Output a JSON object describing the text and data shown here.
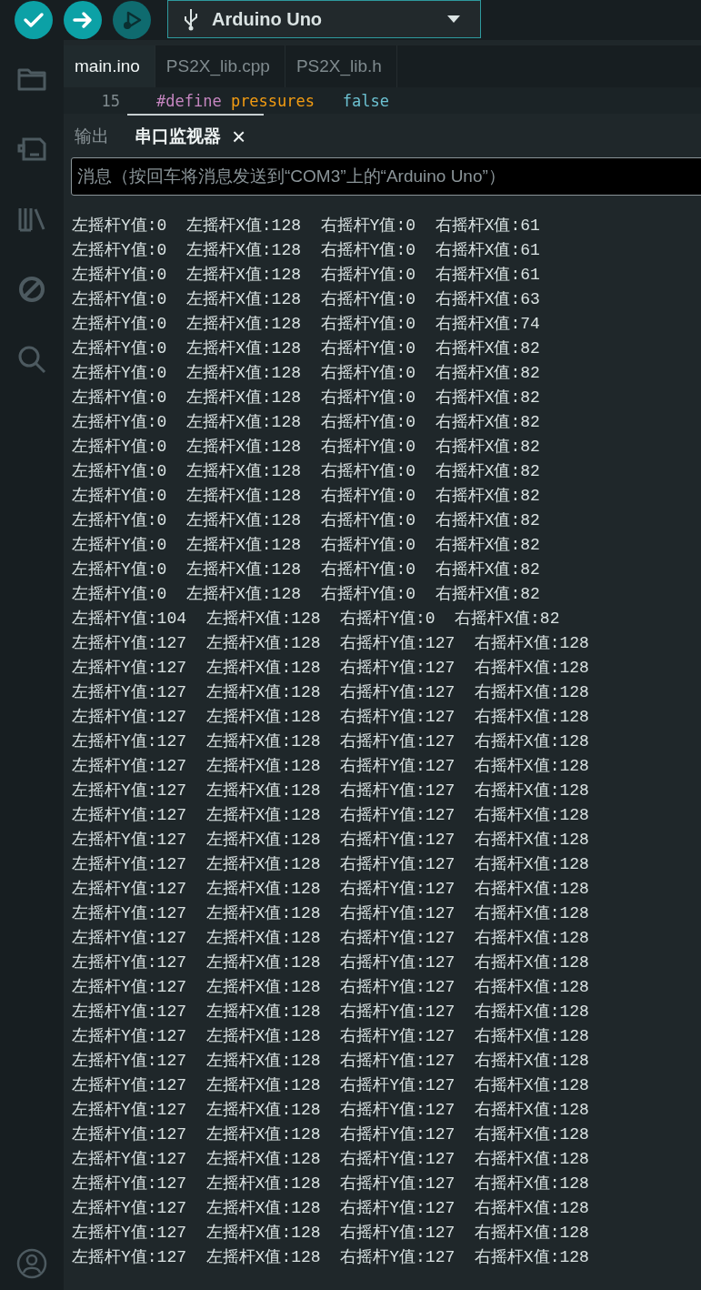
{
  "toolbar": {
    "buttons": [
      {
        "kind": "verify",
        "disabled": false
      },
      {
        "kind": "upload",
        "disabled": false
      },
      {
        "kind": "debug",
        "disabled": true
      }
    ],
    "board": "Arduino Uno"
  },
  "sidebar": {
    "items": [
      {
        "kind": "folder"
      },
      {
        "kind": "board"
      },
      {
        "kind": "library"
      },
      {
        "kind": "debug"
      },
      {
        "kind": "search"
      }
    ],
    "bottom": [
      {
        "kind": "account"
      }
    ]
  },
  "tabs": [
    {
      "label": "main.ino",
      "selected": true
    },
    {
      "label": "PS2X_lib.cpp",
      "selected": false
    },
    {
      "label": "PS2X_lib.h",
      "selected": false
    }
  ],
  "code_lines": [
    {
      "number": "15",
      "tokens": [
        {
          "kind": "directive",
          "text": "#define"
        },
        {
          "kind": "name",
          "text": " pressures"
        },
        {
          "kind": "value",
          "text": "   false"
        }
      ]
    }
  ],
  "panel": {
    "tabs": [
      {
        "label": "输出",
        "selected": false,
        "closable": false
      },
      {
        "label": "串口监视器",
        "selected": true,
        "closable": true
      }
    ],
    "close_glyph": "×",
    "message_field": {
      "placeholder": "消息（按回车将消息发送到“COM3”上的“Arduino Uno”）"
    },
    "lines": [
      "左摇杆Y值:0  左摇杆X值:128  右摇杆Y值:0  右摇杆X值:61",
      "左摇杆Y值:0  左摇杆X值:128  右摇杆Y值:0  右摇杆X值:61",
      "左摇杆Y值:0  左摇杆X值:128  右摇杆Y值:0  右摇杆X值:61",
      "左摇杆Y值:0  左摇杆X值:128  右摇杆Y值:0  右摇杆X值:63",
      "左摇杆Y值:0  左摇杆X值:128  右摇杆Y值:0  右摇杆X值:74",
      "左摇杆Y值:0  左摇杆X值:128  右摇杆Y值:0  右摇杆X值:82",
      "左摇杆Y值:0  左摇杆X值:128  右摇杆Y值:0  右摇杆X值:82",
      "左摇杆Y值:0  左摇杆X值:128  右摇杆Y值:0  右摇杆X值:82",
      "左摇杆Y值:0  左摇杆X值:128  右摇杆Y值:0  右摇杆X值:82",
      "左摇杆Y值:0  左摇杆X值:128  右摇杆Y值:0  右摇杆X值:82",
      "左摇杆Y值:0  左摇杆X值:128  右摇杆Y值:0  右摇杆X值:82",
      "左摇杆Y值:0  左摇杆X值:128  右摇杆Y值:0  右摇杆X值:82",
      "左摇杆Y值:0  左摇杆X值:128  右摇杆Y值:0  右摇杆X值:82",
      "左摇杆Y值:0  左摇杆X值:128  右摇杆Y值:0  右摇杆X值:82",
      "左摇杆Y值:0  左摇杆X值:128  右摇杆Y值:0  右摇杆X值:82",
      "左摇杆Y值:0  左摇杆X值:128  右摇杆Y值:0  右摇杆X值:82",
      "左摇杆Y值:104  左摇杆X值:128  右摇杆Y值:0  右摇杆X值:82",
      "左摇杆Y值:127  左摇杆X值:128  右摇杆Y值:127  右摇杆X值:128",
      "左摇杆Y值:127  左摇杆X值:128  右摇杆Y值:127  右摇杆X值:128",
      "左摇杆Y值:127  左摇杆X值:128  右摇杆Y值:127  右摇杆X值:128",
      "左摇杆Y值:127  左摇杆X值:128  右摇杆Y值:127  右摇杆X值:128",
      "左摇杆Y值:127  左摇杆X值:128  右摇杆Y值:127  右摇杆X值:128",
      "左摇杆Y值:127  左摇杆X值:128  右摇杆Y值:127  右摇杆X值:128",
      "左摇杆Y值:127  左摇杆X值:128  右摇杆Y值:127  右摇杆X值:128",
      "左摇杆Y值:127  左摇杆X值:128  右摇杆Y值:127  右摇杆X值:128",
      "左摇杆Y值:127  左摇杆X值:128  右摇杆Y值:127  右摇杆X值:128",
      "左摇杆Y值:127  左摇杆X值:128  右摇杆Y值:127  右摇杆X值:128",
      "左摇杆Y值:127  左摇杆X值:128  右摇杆Y值:127  右摇杆X值:128",
      "左摇杆Y值:127  左摇杆X值:128  右摇杆Y值:127  右摇杆X值:128",
      "左摇杆Y值:127  左摇杆X值:128  右摇杆Y值:127  右摇杆X值:128",
      "左摇杆Y值:127  左摇杆X值:128  右摇杆Y值:127  右摇杆X值:128",
      "左摇杆Y值:127  左摇杆X值:128  右摇杆Y值:127  右摇杆X值:128",
      "左摇杆Y值:127  左摇杆X值:128  右摇杆Y值:127  右摇杆X值:128",
      "左摇杆Y值:127  左摇杆X值:128  右摇杆Y值:127  右摇杆X值:128",
      "左摇杆Y值:127  左摇杆X值:128  右摇杆Y值:127  右摇杆X值:128",
      "左摇杆Y值:127  左摇杆X值:128  右摇杆Y值:127  右摇杆X值:128",
      "左摇杆Y值:127  左摇杆X值:128  右摇杆Y值:127  右摇杆X值:128",
      "左摇杆Y值:127  左摇杆X值:128  右摇杆Y值:127  右摇杆X值:128",
      "左摇杆Y值:127  左摇杆X值:128  右摇杆Y值:127  右摇杆X值:128",
      "左摇杆Y值:127  左摇杆X值:128  右摇杆Y值:127  右摇杆X值:128",
      "左摇杆Y值:127  左摇杆X值:128  右摇杆Y值:127  右摇杆X值:128",
      "左摇杆Y值:127  左摇杆X值:128  右摇杆Y值:127  右摇杆X值:128",
      "左摇杆Y值:127  左摇杆X值:128  右摇杆Y值:127  右摇杆X值:128"
    ]
  }
}
